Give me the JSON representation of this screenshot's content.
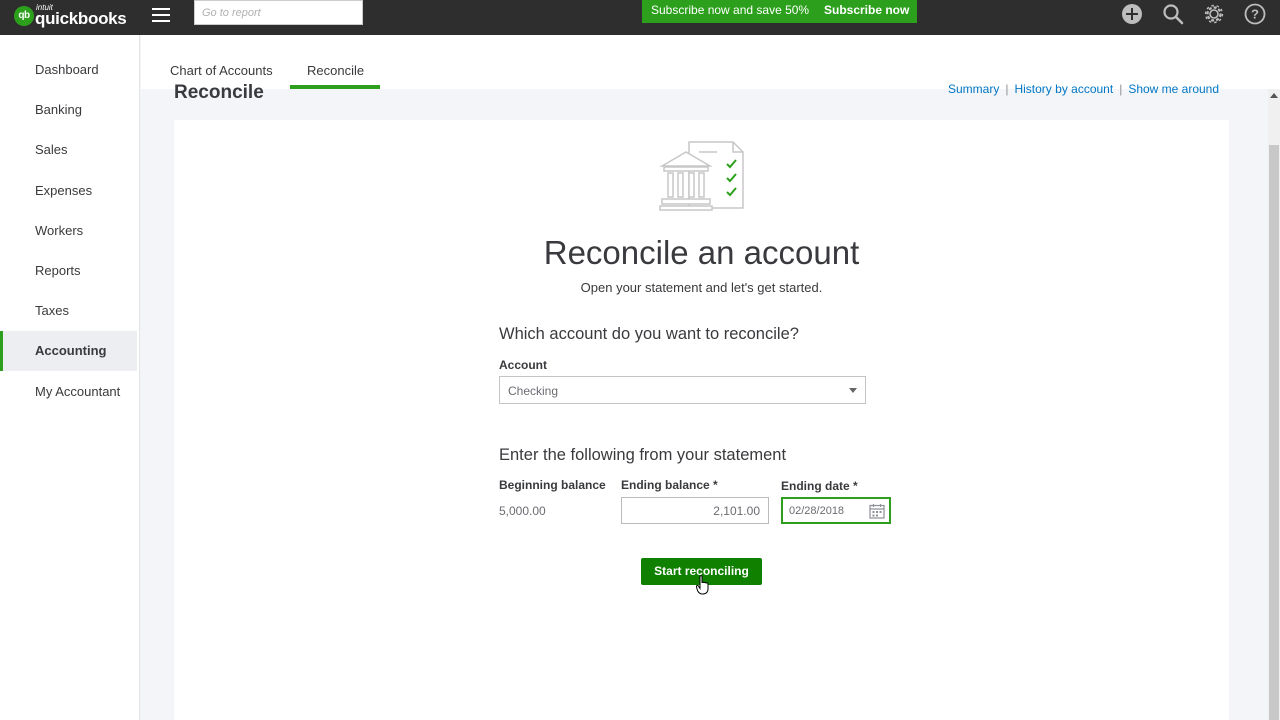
{
  "app": {
    "logo_brand": "intuit",
    "logo_name": "quickbooks",
    "logo_badge": "qb",
    "search_placeholder": "Go to report",
    "promo_text": "Subscribe now and save 50%",
    "promo_button": "Subscribe now",
    "icons": [
      "hamburger-icon",
      "plus-icon",
      "search-icon",
      "gear-icon",
      "help-icon"
    ]
  },
  "sidebar": {
    "items": [
      {
        "label": "Dashboard"
      },
      {
        "label": "Banking"
      },
      {
        "label": "Sales"
      },
      {
        "label": "Expenses"
      },
      {
        "label": "Workers"
      },
      {
        "label": "Reports"
      },
      {
        "label": "Taxes"
      },
      {
        "label": "Accounting",
        "active": true
      },
      {
        "label": "My Accountant"
      }
    ]
  },
  "tabs": [
    {
      "label": "Chart of Accounts"
    },
    {
      "label": "Reconcile",
      "active": true
    }
  ],
  "page": {
    "title": "Reconcile",
    "links": [
      "Summary",
      "History by account",
      "Show me around"
    ]
  },
  "card": {
    "title": "Reconcile an account",
    "subtitle": "Open your statement and let's get started.",
    "account_question": "Which account do you want to reconcile?",
    "account_label": "Account",
    "account_value": "Checking",
    "statement_heading": "Enter the following from your statement",
    "beginning_balance_label": "Beginning balance",
    "beginning_balance_value": "5,000.00",
    "ending_balance_label": "Ending balance *",
    "ending_balance_value": "2,101.00",
    "ending_date_label": "Ending date *",
    "ending_date_value": "02/28/2018",
    "start_button": "Start reconciling"
  },
  "colors": {
    "brand_green": "#2ca01c",
    "button_green": "#108000",
    "topbar": "#2e2e2e",
    "link_blue": "#0077c5"
  }
}
